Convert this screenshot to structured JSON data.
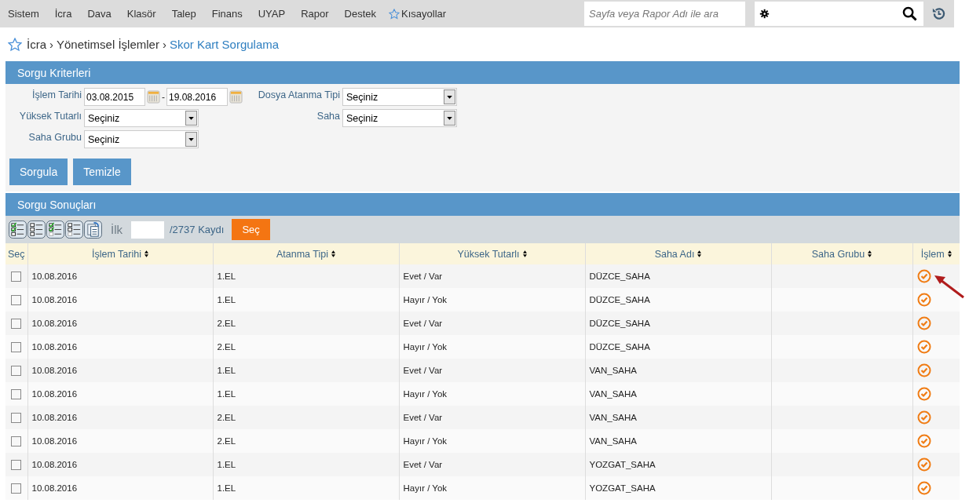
{
  "menu": [
    {
      "label": "Sistem"
    },
    {
      "label": "İcra"
    },
    {
      "label": "Dava"
    },
    {
      "label": "Klasör"
    },
    {
      "label": "Talep"
    },
    {
      "label": "Finans"
    },
    {
      "label": "UYAP"
    },
    {
      "label": "Rapor"
    },
    {
      "label": "Destek"
    }
  ],
  "shortcuts": {
    "label": "Kısayollar"
  },
  "search": {
    "placeholder": "Sayfa veya Rapor Adı ile ara"
  },
  "breadcrumb": {
    "separator": "›",
    "items": [
      "İcra",
      "Yönetimsel İşlemler",
      "Skor Kart Sorgulama"
    ]
  },
  "criteria": {
    "title": "Sorgu Kriterleri",
    "date": {
      "label": "İşlem Tarihi",
      "from": "03.08.2015",
      "separator": "-",
      "to": "19.08.2016"
    },
    "fields": [
      {
        "label": "Dosya Atanma Tipi",
        "value": "Seçiniz"
      },
      {
        "label": "Yüksek Tutarlı",
        "value": "Seçiniz"
      },
      {
        "label": "Saha",
        "value": "Seçiniz"
      },
      {
        "label": "Saha Grubu",
        "value": "Seçiniz"
      }
    ],
    "buttons": [
      "Sorgula",
      "Temizle"
    ]
  },
  "results": {
    "title": "Sorgu Sonuçları",
    "pager": {
      "label": "İlk",
      "total": "/2737 Kaydı",
      "button": "Seç"
    },
    "columns": [
      "Seç",
      "İşlem Tarihi",
      "Atanma Tipi",
      "Yüksek Tutarlı",
      "Saha Adı",
      "Saha Grubu",
      "İşlem"
    ],
    "rows": [
      {
        "selected": false,
        "cells": [
          "",
          "10.08.2016",
          "1.EL",
          "Evet / Var",
          "DÜZCE_SAHA",
          "",
          ""
        ]
      },
      {
        "selected": false,
        "cells": [
          "",
          "10.08.2016",
          "1.EL",
          "Hayır / Yok",
          "DÜZCE_SAHA",
          "",
          ""
        ]
      },
      {
        "selected": false,
        "cells": [
          "",
          "10.08.2016",
          "2.EL",
          "Evet / Var",
          "DÜZCE_SAHA",
          "",
          ""
        ]
      },
      {
        "selected": false,
        "cells": [
          "",
          "10.08.2016",
          "2.EL",
          "Hayır / Yok",
          "DÜZCE_SAHA",
          "",
          ""
        ]
      },
      {
        "selected": false,
        "cells": [
          "",
          "10.08.2016",
          "1.EL",
          "Evet / Var",
          "VAN_SAHA",
          "",
          ""
        ]
      },
      {
        "selected": false,
        "cells": [
          "",
          "10.08.2016",
          "1.EL",
          "Hayır / Yok",
          "VAN_SAHA",
          "",
          ""
        ]
      },
      {
        "selected": false,
        "cells": [
          "",
          "10.08.2016",
          "2.EL",
          "Evet / Var",
          "VAN_SAHA",
          "",
          ""
        ]
      },
      {
        "selected": false,
        "cells": [
          "",
          "10.08.2016",
          "2.EL",
          "Hayır / Yok",
          "VAN_SAHA",
          "",
          ""
        ]
      },
      {
        "selected": false,
        "cells": [
          "",
          "10.08.2016",
          "1.EL",
          "Evet / Var",
          "YOZGAT_SAHA",
          "",
          ""
        ]
      },
      {
        "selected": false,
        "cells": [
          "",
          "10.08.2016",
          "1.EL",
          "Hayır / Yok",
          "YOZGAT_SAHA",
          "",
          ""
        ]
      }
    ]
  }
}
